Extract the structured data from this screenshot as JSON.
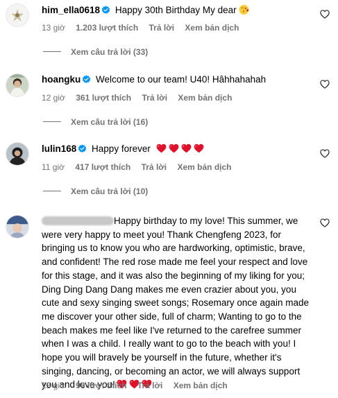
{
  "comments": [
    {
      "username": "him_ella0618",
      "text": "Happy 30th Birthday My dear",
      "time": "13 giờ",
      "likes": "1.203 lượt thích",
      "reply_label": "Trả lời",
      "translate_label": "Xem bản dịch",
      "view_replies": "Xem câu trả lời (33)"
    },
    {
      "username": "hoangku",
      "text": "Welcome to our team! U40! Hâhhahahah",
      "time": "12 giờ",
      "likes": "361 lượt thích",
      "reply_label": "Trả lời",
      "translate_label": "Xem bản dịch",
      "view_replies": "Xem câu trả lời (16)"
    },
    {
      "username": "lulin168",
      "text": "Happy forever",
      "time": "11 giờ",
      "likes": "417 lượt thích",
      "reply_label": "Trả lời",
      "translate_label": "Xem bản dịch",
      "view_replies": "Xem câu trả lời (10)"
    },
    {
      "username": "",
      "text": "Happy birthday to my love! This summer, we were very happy to meet you! Thank Chengfeng 2023, for bringing us to know you who are hardworking, optimistic, brave, and confident! The red rose made me feel your respect and love for this stage, and it was also the beginning of my liking for you; Ding Ding Dang Dang makes me even crazier about you, you cute and sexy singing sweet songs; Rosemary once again made me discover your other side, full of charm; Wanting to go to the beach makes me feel like I've returned to the carefree summer when I was a child. I really want to go to the beach with you! I hope you will bravely be yourself in the future, whether it's singing, dancing, or becoming an actor, we will always support you and love you!",
      "time": "13 giờ",
      "likes": "98 lượt thích",
      "reply_label": "Trả lời",
      "translate_label": "Xem bản dịch"
    }
  ],
  "colors": {
    "verified": "#0095f6",
    "meta_text": "#737373",
    "heart_emoji": "#e0112b"
  },
  "icons": {
    "verified": "verified-badge-icon",
    "like": "heart-outline-icon",
    "emoji_face": "face-blowing-kiss-emoji",
    "emoji_heart": "red-heart-emoji"
  }
}
